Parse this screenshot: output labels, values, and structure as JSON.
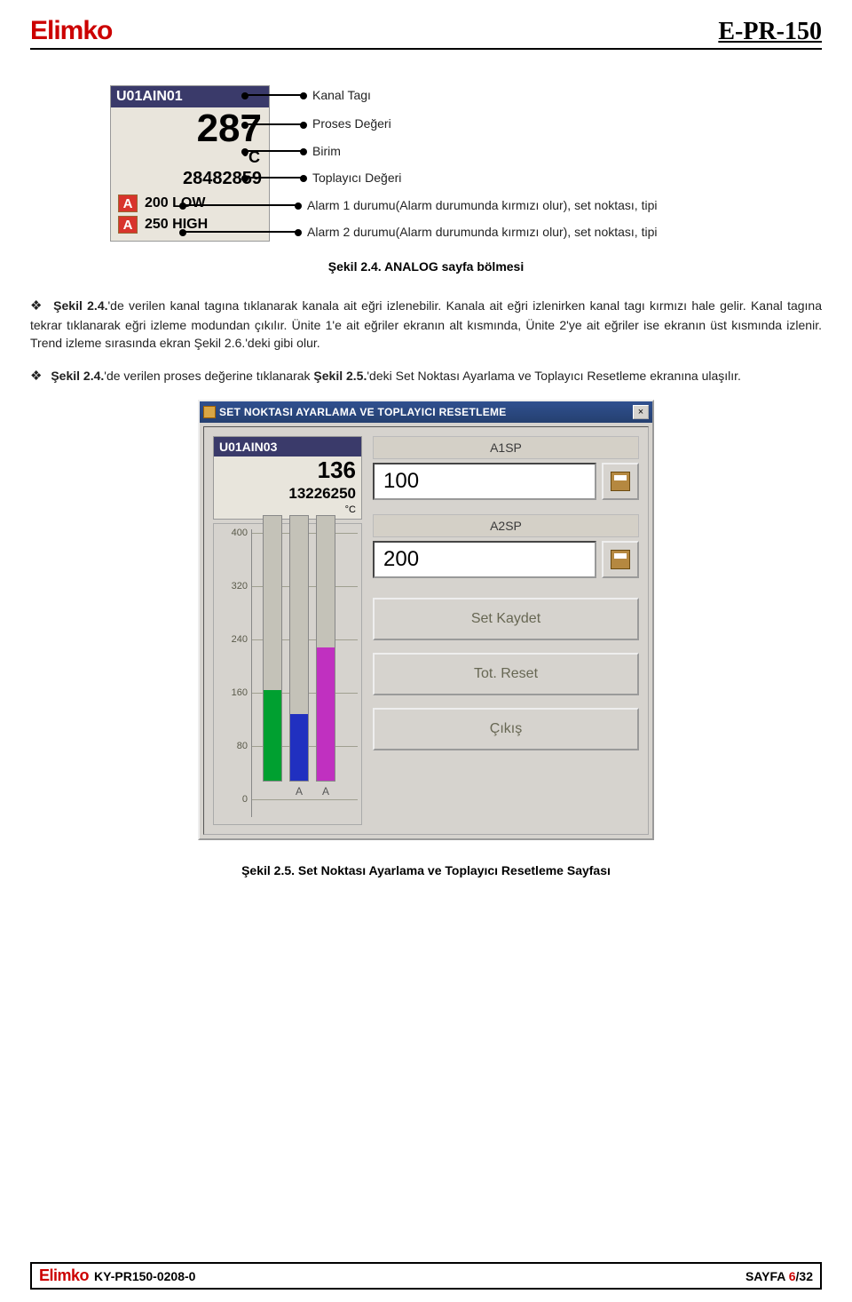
{
  "header": {
    "brand": "Elimko",
    "doc_code": "E-PR-150"
  },
  "fig24": {
    "card": {
      "tag": "U01AIN01",
      "value": "287",
      "unit": "°C",
      "totalizer": "28482859",
      "alarm1_badge": "A",
      "alarm1_text": "200 LOW",
      "alarm2_badge": "A",
      "alarm2_text": "250 HIGH"
    },
    "callouts": {
      "c1": "Kanal Tagı",
      "c2": "Proses Değeri",
      "c3": "Birim",
      "c4": "Toplayıcı Değeri",
      "c5": "Alarm 1 durumu(Alarm durumunda kırmızı olur), set noktası, tipi",
      "c6": "Alarm 2 durumu(Alarm durumunda kırmızı olur), set noktası, tipi"
    },
    "caption_bold": "Şekil 2.4.",
    "caption_rest": " ANALOG sayfa bölmesi"
  },
  "paragraphs": {
    "p1_bold": "Şekil 2.4.",
    "p1_rest": "'de verilen kanal tagına tıklanarak kanala ait eğri izlenebilir. Kanala ait eğri izlenirken kanal tagı kırmızı hale gelir. Kanal tagına tekrar tıklanarak eğri izleme modundan çıkılır. Ünite 1'e ait eğriler ekranın alt kısmında, Ünite 2'ye ait eğriler ise ekranın üst kısmında izlenir. Trend izleme sırasında ekran Şekil 2.6.'deki gibi olur.",
    "p2_bold1": "Şekil 2.4.",
    "p2_mid": "'de verilen proses değerine tıklanarak ",
    "p2_bold2": "Şekil 2.5.",
    "p2_rest": "'deki Set Noktası Ayarlama ve Toplayıcı Resetleme ekranına ulaşılır."
  },
  "dialog": {
    "title": "SET NOKTASI AYARLAMA VE TOPLAYICI RESETLEME",
    "close": "×",
    "channel_tag": "U01AIN03",
    "channel_val": "136",
    "channel_total": "13226250",
    "channel_unit": "°C",
    "a1sp_label": "A1SP",
    "a1sp_value": "100",
    "a2sp_label": "A2SP",
    "a2sp_value": "200",
    "btn_save": "Set Kaydet",
    "btn_reset": "Tot. Reset",
    "btn_exit": "Çıkış"
  },
  "chart_data": {
    "type": "bar",
    "ylim": [
      0,
      400
    ],
    "ticks": [
      0,
      80,
      160,
      240,
      320,
      400
    ],
    "series": [
      {
        "name": "value",
        "value": 136,
        "color": "#00a030"
      },
      {
        "name": "a1sp",
        "value": 100,
        "color": "#2030c0",
        "label": "A"
      },
      {
        "name": "a2sp",
        "value": 200,
        "color": "#c030c0",
        "label": "A"
      }
    ]
  },
  "fig25_caption_bold": "Şekil 2.5.",
  "fig25_caption_rest": " Set Noktası Ayarlama ve Toplayıcı Resetleme Sayfası",
  "footer": {
    "brand": "Elimko",
    "doc_no": "KY-PR150-0208-0",
    "page_label": "SAYFA ",
    "page_cur": "6",
    "page_total": "/32"
  }
}
